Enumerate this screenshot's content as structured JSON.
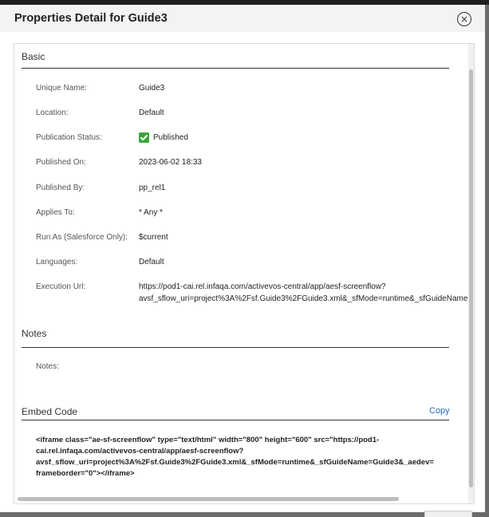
{
  "dialog": {
    "title": "Properties Detail for Guide3",
    "close_icon": "×"
  },
  "basic": {
    "title": "Basic",
    "properties": [
      {
        "label": "Unique Name:",
        "value": "Guide3"
      },
      {
        "label": "Location:",
        "value": "Default"
      },
      {
        "label": "Publication Status:",
        "value": "Published"
      },
      {
        "label": "Published On:",
        "value": "2023-06-02 18:33"
      },
      {
        "label": "Published By:",
        "value": "pp_rel1"
      },
      {
        "label": "Applies To:",
        "value": "* Any *"
      },
      {
        "label": "Run As (Salesforce Only):",
        "value": "$current"
      },
      {
        "label": "Languages:",
        "value": "Default"
      },
      {
        "label": "Execution Url:",
        "value_line1": "https://pod1-cai.rel.infaqa.com/activevos-central/app/aesf-screenflow?",
        "value_line2": "avsf_sflow_uri=project%3A%2Fsf.Guide3%2FGuide3.xml&_sfMode=runtime&_sfGuideName="
      }
    ]
  },
  "notes": {
    "title": "Notes",
    "label": "Notes:"
  },
  "embed": {
    "title": "Embed Code",
    "copy_label": "Copy",
    "line1": "<iframe class=\"ae-sf-screenflow\" type=\"text/html\" width=\"800\" height=\"600\" src=\"https://pod1-",
    "line2": "cai.rel.infaqa.com/activevos-central/app/aesf-screenflow?",
    "line3": "avsf_sflow_uri=project%3A%2Fsf.Guide3%2FGuide3.xml&_sfMode=runtime&_sfGuideName=Guide3&_aedev=",
    "line4": "frameborder=\"0\"></iframe>"
  },
  "colors": {
    "accent_link": "#2a6bc2",
    "status_published": "#3aa53a"
  }
}
